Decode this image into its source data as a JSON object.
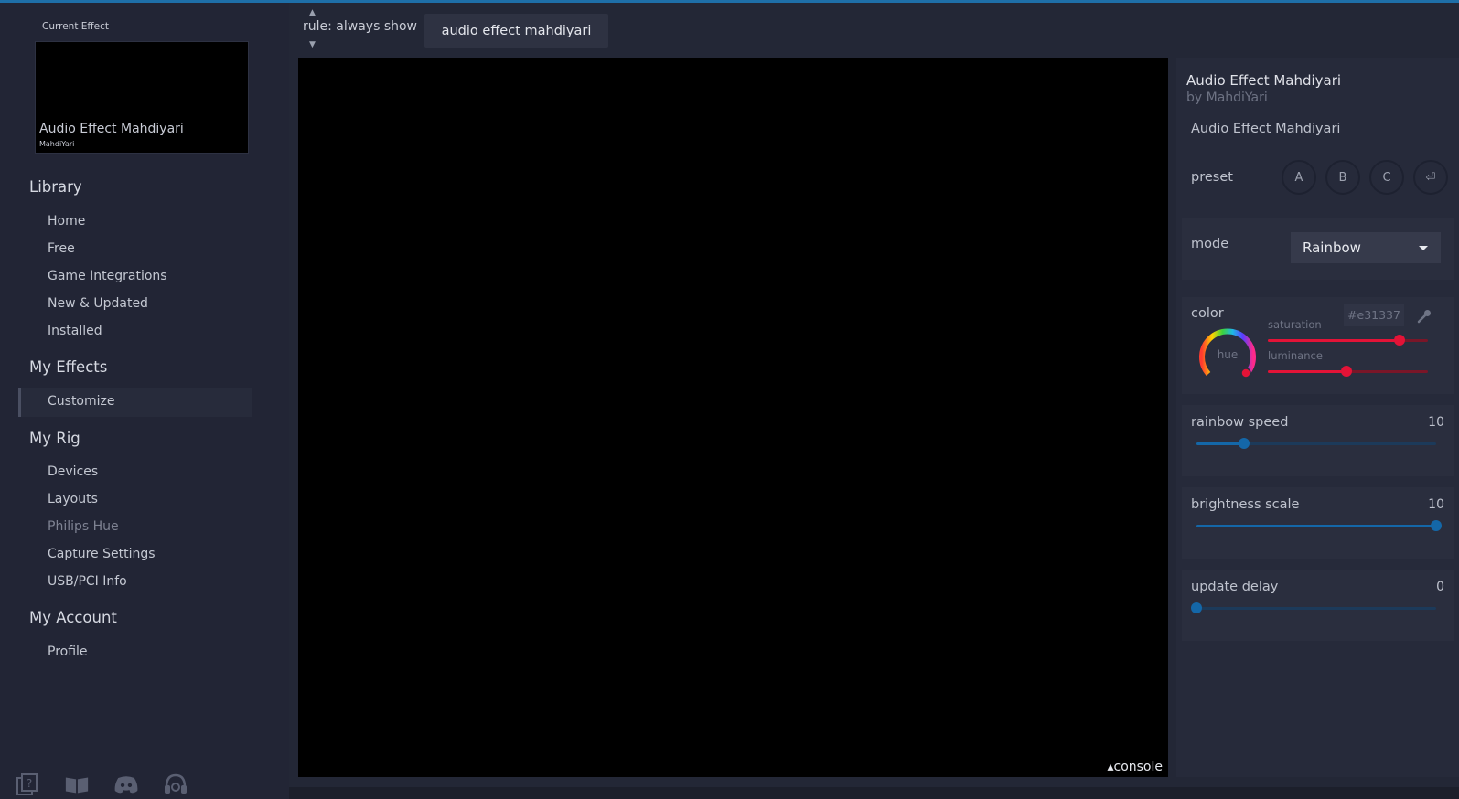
{
  "sidebar": {
    "current_effect_label": "Current Effect",
    "preview": {
      "title": "Audio Effect Mahdiyari",
      "author": "MahdiYari"
    },
    "sections": [
      {
        "title": "Library",
        "items": [
          "Home",
          "Free",
          "Game Integrations",
          "New & Updated",
          "Installed"
        ]
      },
      {
        "title": "My Effects",
        "items": [
          "Customize"
        ]
      },
      {
        "title": "My Rig",
        "items": [
          "Devices",
          "Layouts",
          "Philips Hue",
          "Capture Settings",
          "USB/PCI Info"
        ]
      },
      {
        "title": "My Account",
        "items": [
          "Profile"
        ]
      }
    ],
    "active_item": "Customize",
    "disabled_item": "Philips Hue",
    "bottom_icons": [
      "help-icon",
      "book-icon",
      "discord-icon",
      "support-headset-icon"
    ]
  },
  "topbar": {
    "rule": "rule: always show",
    "rule_up": "▲",
    "rule_down": "▼",
    "effect_tab": "audio effect mahdiyari"
  },
  "canvas": {
    "console_label": "▴console"
  },
  "panel": {
    "effect_name": "Audio Effect Mahdiyari",
    "author": "by MahdiYari",
    "description": "Audio Effect Mahdiyari",
    "preset_label": "preset",
    "presets": [
      "A",
      "B",
      "C",
      "⏎"
    ],
    "mode": {
      "label": "mode",
      "value": "Rainbow"
    },
    "color": {
      "label": "color",
      "hex": "#e31337",
      "hue_label": "hue",
      "saturation_label": "saturation",
      "luminance_label": "luminance",
      "saturation": 0.82,
      "luminance": 0.49
    },
    "controls": [
      {
        "label": "rainbow speed",
        "value": "10",
        "fraction": 0.2
      },
      {
        "label": "brightness scale",
        "value": "10",
        "fraction": 1.0
      },
      {
        "label": "update delay",
        "value": "0",
        "fraction": 0.0
      }
    ],
    "colors": {
      "accent_red": "#e31337",
      "slider_blue": "#1467a8"
    }
  }
}
